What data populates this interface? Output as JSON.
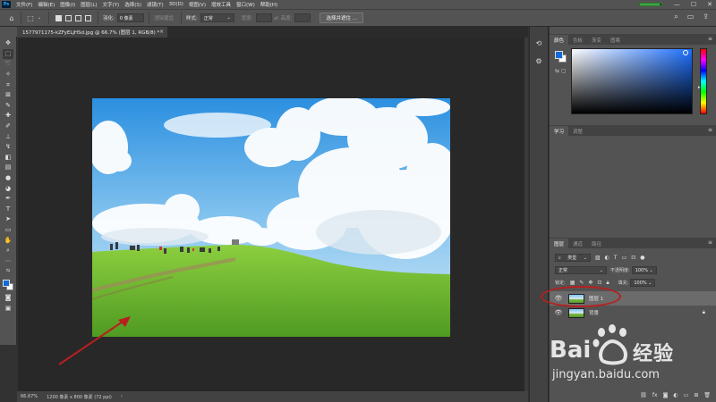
{
  "app": {
    "logo": "Ps"
  },
  "menubar": {
    "items": [
      "文件(F)",
      "编辑(E)",
      "图像(I)",
      "图层(L)",
      "文字(Y)",
      "选择(S)",
      "滤镜(T)",
      "3D(D)",
      "视图(V)",
      "增效工具",
      "窗口(W)",
      "帮助(H)"
    ]
  },
  "window_controls": {
    "minimize": "—",
    "maximize": "☐",
    "close": "✕"
  },
  "options": {
    "feather_label": "羽化:",
    "feather_value": "0 像素",
    "antialias_label": "消除锯齿",
    "style_label": "样式:",
    "style_value": "正常",
    "width_label": "宽度:",
    "height_label": "高度:",
    "select_subject_label": "选择并遮住 ..."
  },
  "document": {
    "tab_title": "1577971175-kZFyELjHSd.jpg @ 66.7% (图层 1, RGB/8) *",
    "close": "×"
  },
  "status": {
    "zoom": "66.67%",
    "doc_info": "1200 像素 x 800 像素 (72 ppi)",
    "arrow": "›"
  },
  "colors": {
    "foreground": "#1469d8",
    "background": "#ffffff",
    "annotation": "#b81f1f"
  },
  "panels": {
    "color_tabs": [
      "颜色",
      "色板",
      "渐变",
      "图案"
    ],
    "learn_tabs": [
      "学习",
      "调整"
    ],
    "layers_tabs": [
      "图层",
      "通道",
      "路径"
    ],
    "menu_icon": "≡"
  },
  "layers": {
    "filter_label": "类型",
    "blend_mode": "正常",
    "opacity_label": "不透明度:",
    "opacity_value": "100%",
    "lock_label": "锁定:",
    "fill_label": "填充:",
    "fill_value": "100%",
    "items": [
      {
        "name": "图层 1",
        "selected": true,
        "locked": false
      },
      {
        "name": "背景",
        "selected": false,
        "locked": true
      }
    ],
    "footer_icons": [
      "link-icon",
      "fx-icon",
      "mask-icon",
      "adjustment-icon",
      "group-icon",
      "new-layer-icon",
      "trash-icon"
    ],
    "fx_label": "fx"
  },
  "watermark": {
    "brand": "Bai",
    "brand_suffix": "经验",
    "url": "jingyan.baidu.com"
  }
}
